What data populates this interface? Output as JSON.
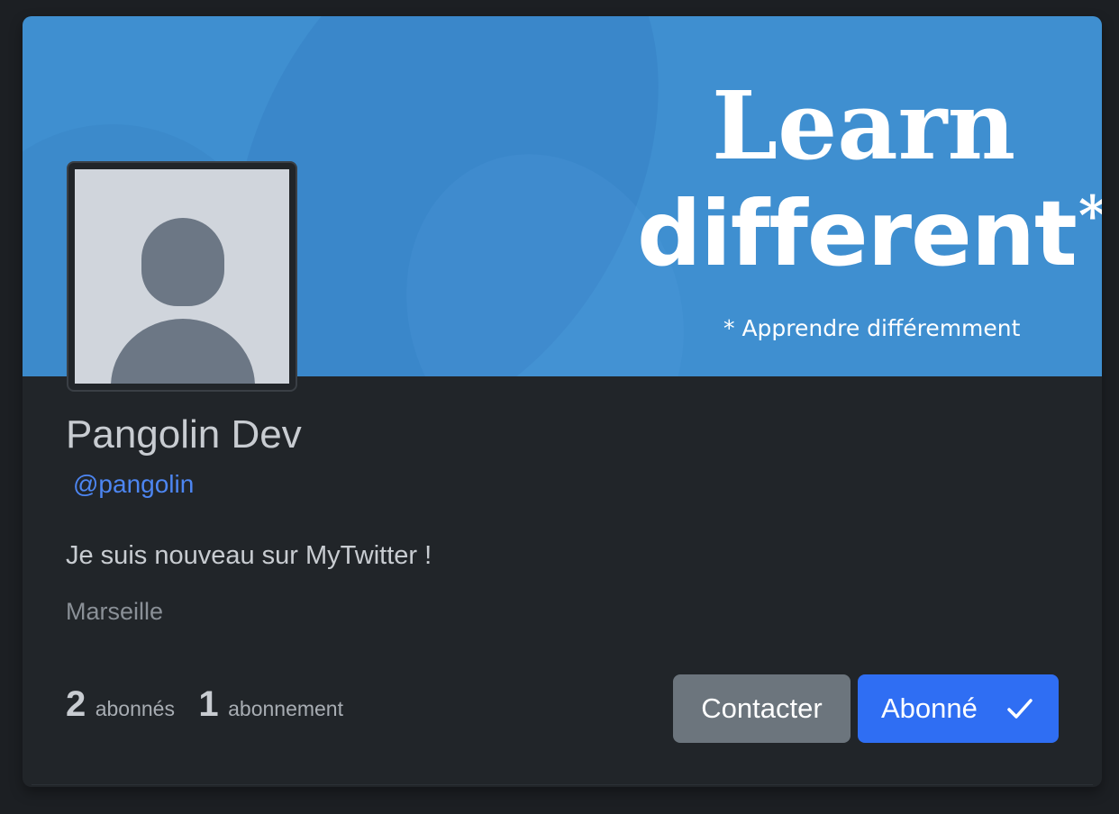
{
  "banner": {
    "line1": "Learn",
    "line2": "different",
    "asterisk": "*",
    "subtitle": "* Apprendre différemment",
    "background": "#3f8fd0"
  },
  "avatar": {
    "icon": "user-silhouette-icon"
  },
  "profile": {
    "name": "Pangolin Dev",
    "handle": "@pangolin",
    "bio": "Je suis nouveau sur MyTwitter !",
    "location": "Marseille"
  },
  "stats": {
    "followers_count": "2",
    "followers_label": "abonnés",
    "following_count": "1",
    "following_label": "abonnement"
  },
  "actions": {
    "contact_label": "Contacter",
    "follow_label": "Abonné",
    "follow_icon": "check-icon"
  },
  "colors": {
    "accent": "#2f6ef3",
    "handle": "#4d86f2",
    "secondary_button": "#6c757d",
    "card_background": "#212529"
  }
}
